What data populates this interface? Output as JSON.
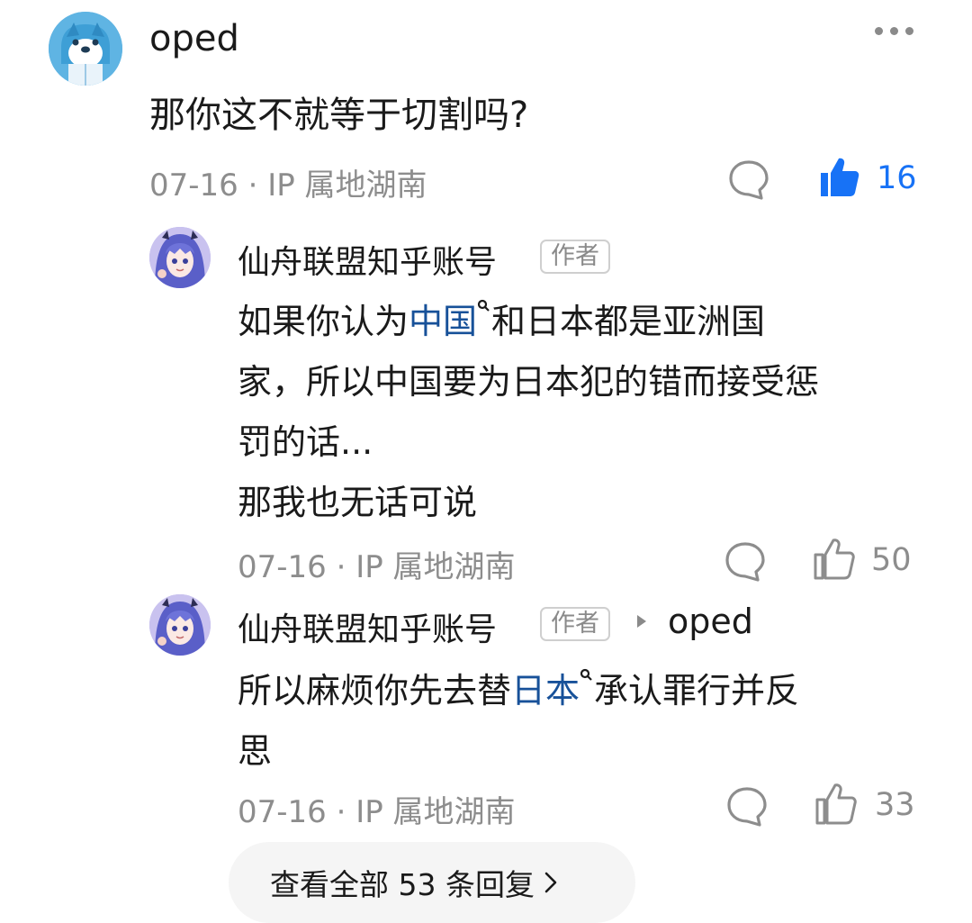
{
  "comment": {
    "user": "oped",
    "text": "那你这不就等于切割吗?",
    "meta": "07-16 · IP 属地湖南",
    "like_count": "16",
    "like_active": true,
    "accent_color": "#1772f6"
  },
  "replies": [
    {
      "user": "仙舟联盟知乎账号",
      "tag": "作者",
      "lines": [
        [
          {
            "t": "如果你认为"
          },
          {
            "t": "中国",
            "link": true
          },
          {
            "t": "和日本都是亚洲国"
          }
        ],
        [
          {
            "t": "家，所以中国要为日本犯的错而接受惩"
          }
        ],
        [
          {
            "t": "罚的话..."
          }
        ],
        [
          {
            "t": "那我也无话可说"
          }
        ]
      ],
      "meta": "07-16 · IP 属地湖南",
      "like_count": "50"
    },
    {
      "user": "仙舟联盟知乎账号",
      "tag": "作者",
      "reply_to": "oped",
      "lines": [
        [
          {
            "t": "所以麻烦你先去替"
          },
          {
            "t": "日本",
            "link": true
          },
          {
            "t": "承认罪行并反"
          }
        ],
        [
          {
            "t": "思"
          }
        ]
      ],
      "meta": "07-16 · IP 属地湖南",
      "like_count": "33"
    }
  ],
  "view_all_label": "查看全部 53 条回复",
  "icons": [
    "more-icon",
    "comment-icon",
    "like-icon",
    "search-icon",
    "chevron-right-icon",
    "triangle-right-icon"
  ]
}
